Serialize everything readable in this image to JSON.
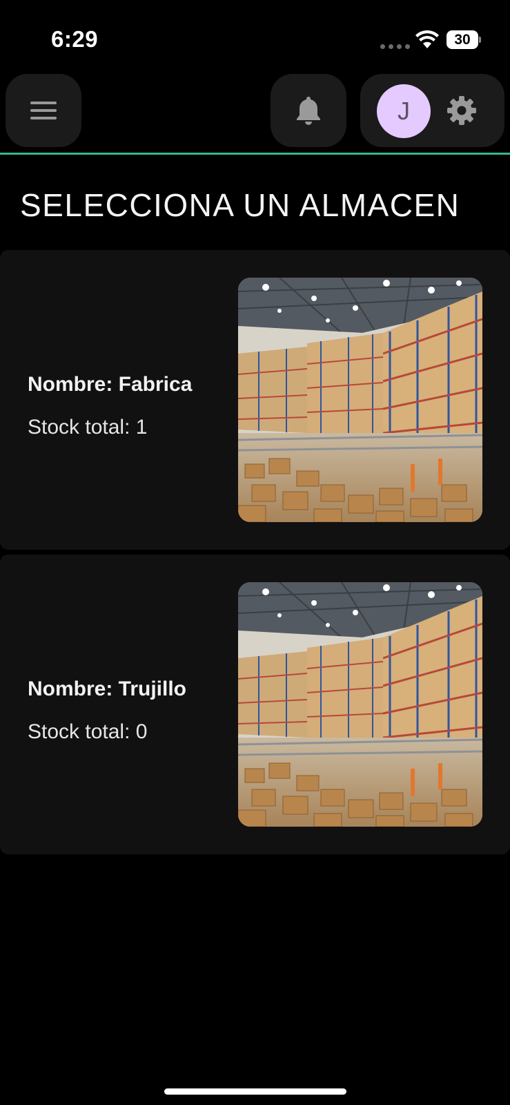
{
  "status_bar": {
    "time": "6:29",
    "battery": "30"
  },
  "header": {
    "menu_icon": "hamburger-menu-icon",
    "bell_icon": "bell-icon",
    "avatar_initial": "J",
    "settings_icon": "gear-icon",
    "divider_color": "#35b891"
  },
  "page": {
    "title": "SELECCIONA UN ALMACEN"
  },
  "warehouses": [
    {
      "name": "Nombre: Fabrica",
      "stock": "Stock total: 1",
      "image": "warehouse-photo"
    },
    {
      "name": "Nombre: Trujillo",
      "stock": "Stock total: 0",
      "image": "warehouse-photo"
    }
  ],
  "colors": {
    "background": "#000000",
    "card": "#121111",
    "header_button": "#1b1b1c",
    "avatar": "#e4caff"
  }
}
